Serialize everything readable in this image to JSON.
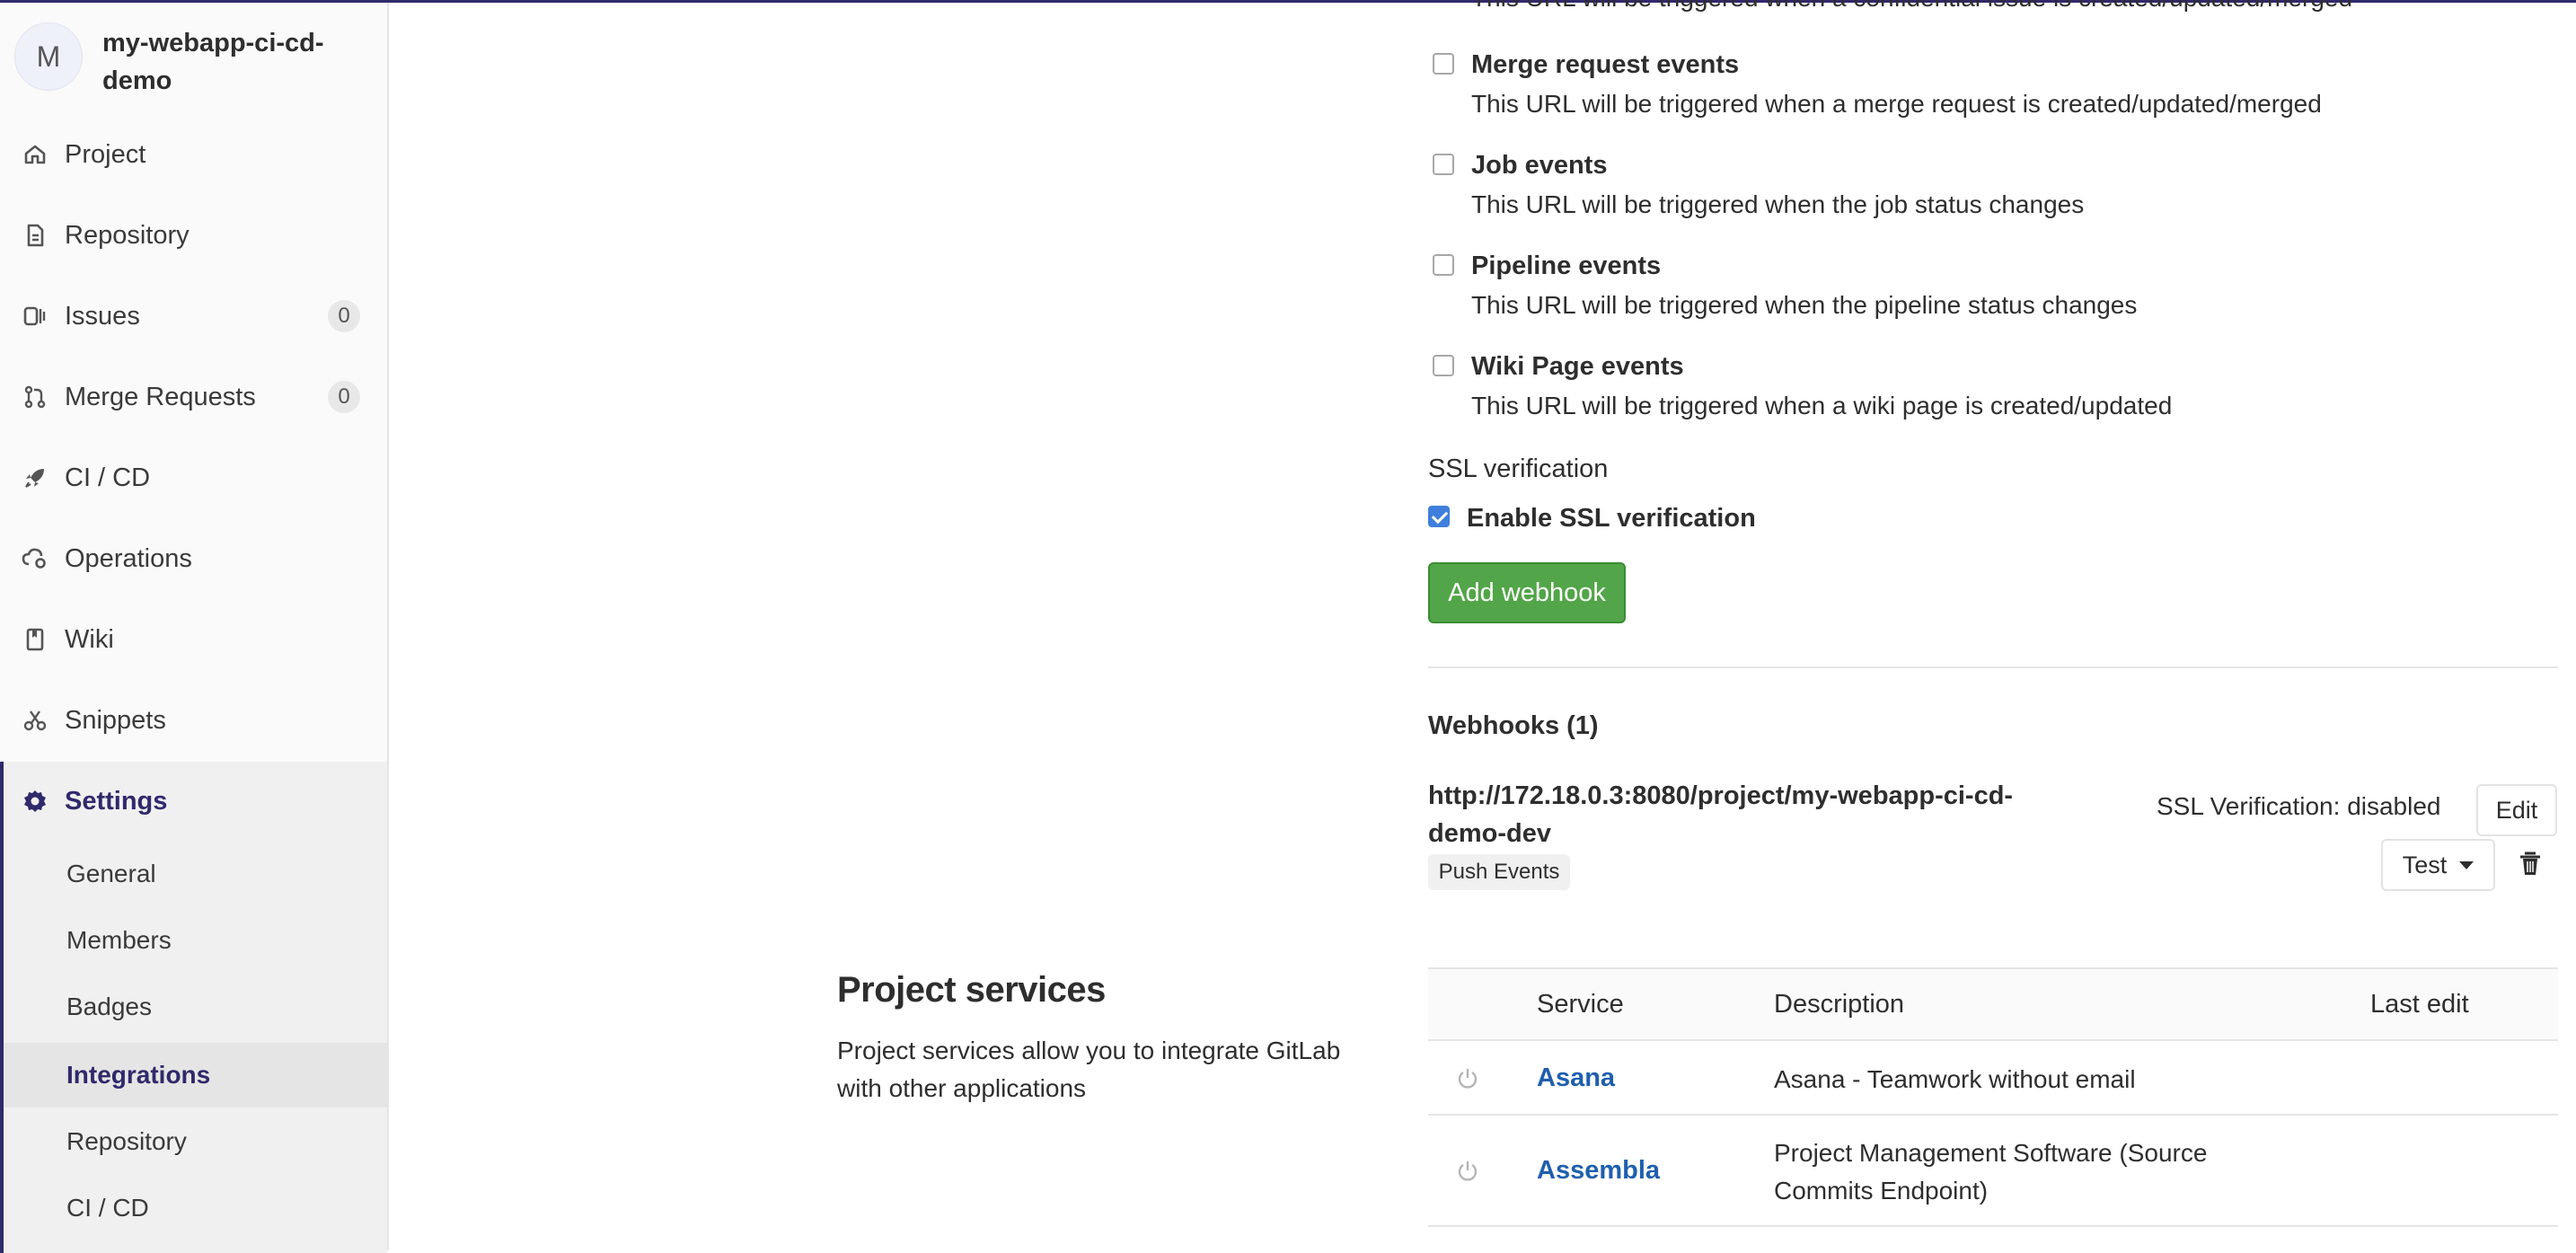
{
  "project": {
    "avatar_letter": "M",
    "name": "my-webapp-ci-cd-demo"
  },
  "sidebar": {
    "items": [
      {
        "label": "Project",
        "icon": "home-icon"
      },
      {
        "label": "Repository",
        "icon": "document-icon"
      },
      {
        "label": "Issues",
        "icon": "issues-icon",
        "count": "0"
      },
      {
        "label": "Merge Requests",
        "icon": "merge-request-icon",
        "count": "0"
      },
      {
        "label": "CI / CD",
        "icon": "rocket-icon"
      },
      {
        "label": "Operations",
        "icon": "cloud-gear-icon"
      },
      {
        "label": "Wiki",
        "icon": "book-icon"
      },
      {
        "label": "Snippets",
        "icon": "scissors-icon"
      },
      {
        "label": "Settings",
        "icon": "gear-icon"
      }
    ],
    "settings_sub": [
      "General",
      "Members",
      "Badges",
      "Integrations",
      "Repository",
      "CI / CD"
    ]
  },
  "events": {
    "clipped_desc": "This URL will be triggered when a confidential issue is created/updated/merged",
    "items": [
      {
        "title": "Merge request events",
        "desc": "This URL will be triggered when a merge request is created/updated/merged",
        "checked": false
      },
      {
        "title": "Job events",
        "desc": "This URL will be triggered when the job status changes",
        "checked": false
      },
      {
        "title": "Pipeline events",
        "desc": "This URL will be triggered when the pipeline status changes",
        "checked": false
      },
      {
        "title": "Wiki Page events",
        "desc": "This URL will be triggered when a wiki page is created/updated",
        "checked": false
      }
    ]
  },
  "ssl": {
    "heading": "SSL verification",
    "checkbox_label": "Enable SSL verification",
    "checked": true
  },
  "add_webhook_label": "Add webhook",
  "webhooks": {
    "heading": "Webhooks (1)",
    "url_line1": "http://172.18.0.3:8080/project/my-webapp-ci-cd-",
    "url_line2": "demo-dev",
    "event_badge": "Push Events",
    "ssl_status": "SSL Verification: disabled",
    "edit_label": "Edit",
    "test_label": "Test"
  },
  "project_services": {
    "title": "Project services",
    "description": "Project services allow you to integrate GitLab with other applications",
    "columns": [
      "Service",
      "Description",
      "Last edit"
    ],
    "rows": [
      {
        "service": "Asana",
        "description": "Asana - Teamwork without email"
      },
      {
        "service": "Assembla",
        "description": "Project Management Software (Source Commits Endpoint)"
      }
    ]
  },
  "colors": {
    "accent": "#2f2a6b",
    "success": "#52a548",
    "link": "#1f5fae"
  }
}
